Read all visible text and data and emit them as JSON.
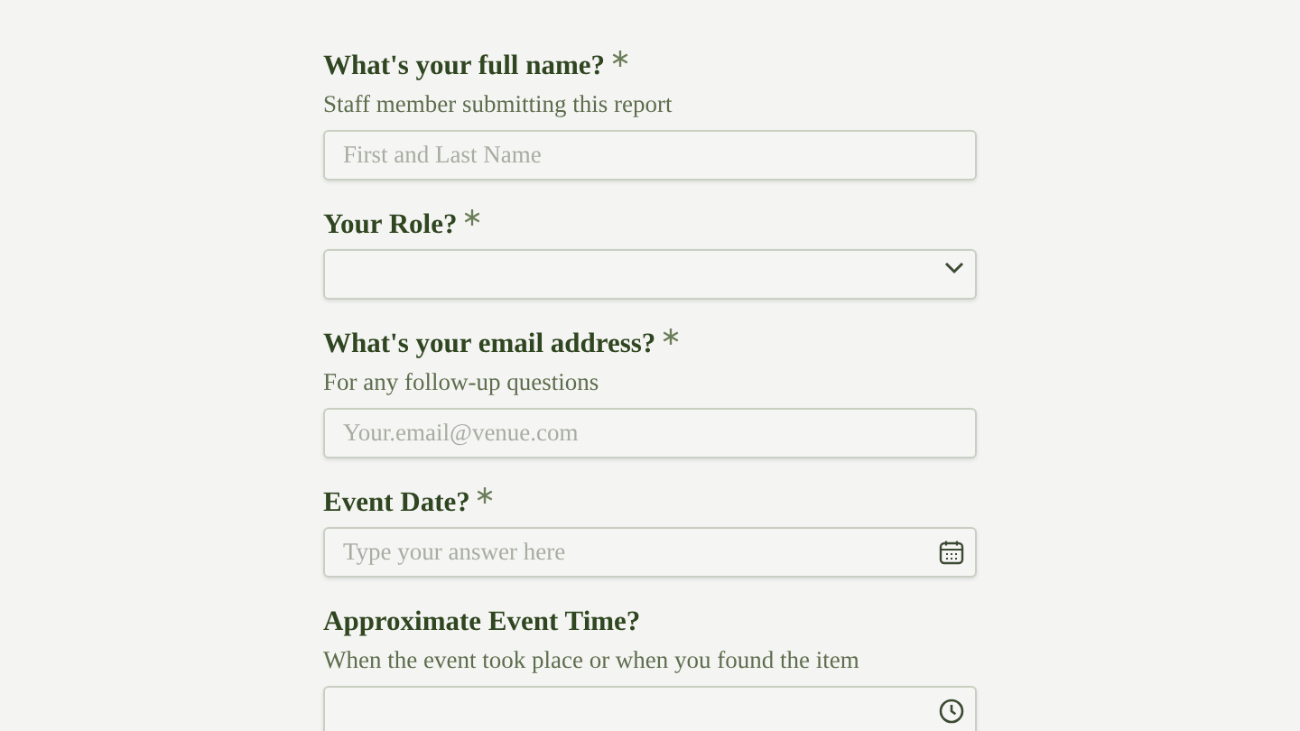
{
  "fields": [
    {
      "kind": "text",
      "label": "What's your full name?",
      "required": true,
      "description": "Staff member submitting this report",
      "placeholder": "First and Last Name"
    },
    {
      "kind": "select",
      "label": "Your Role?",
      "required": true
    },
    {
      "kind": "text",
      "label": "What's your email address?",
      "required": true,
      "description": "For any follow-up questions",
      "placeholder": "Your.email@venue.com"
    },
    {
      "kind": "date",
      "label": "Event Date?",
      "required": true,
      "placeholder": "Type your answer here"
    },
    {
      "kind": "time",
      "label": "Approximate Event Time?",
      "required": false,
      "description": "When the event took place or when you found the item"
    }
  ]
}
